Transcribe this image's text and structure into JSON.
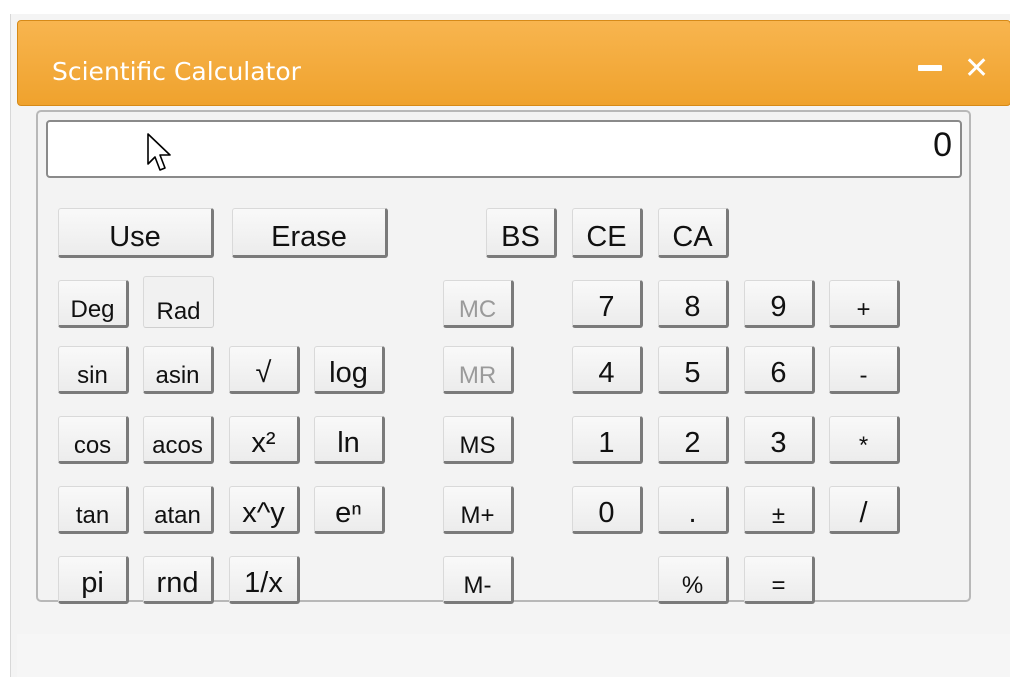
{
  "window": {
    "title": "Scientific Calculator",
    "close_glyph": "✕"
  },
  "display": {
    "value": "0"
  },
  "buttons": {
    "use": "Use",
    "erase": "Erase",
    "bs": "BS",
    "ce": "CE",
    "ca": "CA",
    "deg": "Deg",
    "rad": "Rad",
    "mc": "MC",
    "mr": "MR",
    "ms": "MS",
    "mplus": "M+",
    "mminus": "M-",
    "sin": "sin",
    "asin": "asin",
    "sqrt": "√",
    "log": "log",
    "cos": "cos",
    "acos": "acos",
    "x2": "x²",
    "ln": "ln",
    "tan": "tan",
    "atan": "atan",
    "xpowy": "x^y",
    "en": "eⁿ",
    "pi": "pi",
    "rnd": "rnd",
    "inv": "1/x",
    "d7": "7",
    "d8": "8",
    "d9": "9",
    "plus": "+",
    "d4": "4",
    "d5": "5",
    "d6": "6",
    "minus": "-",
    "d1": "1",
    "d2": "2",
    "d3": "3",
    "mul": "*",
    "d0": "0",
    "dot": ".",
    "pm": "±",
    "div": "/",
    "pct": "%",
    "eq": "="
  },
  "colors": {
    "titlebar": "#f2a733",
    "title_text": "#ffffff",
    "disabled_text": "#9a9a9a"
  },
  "icons": {
    "minimize": "minimize-icon",
    "close": "close-icon",
    "cursor": "mouse-pointer-icon"
  }
}
